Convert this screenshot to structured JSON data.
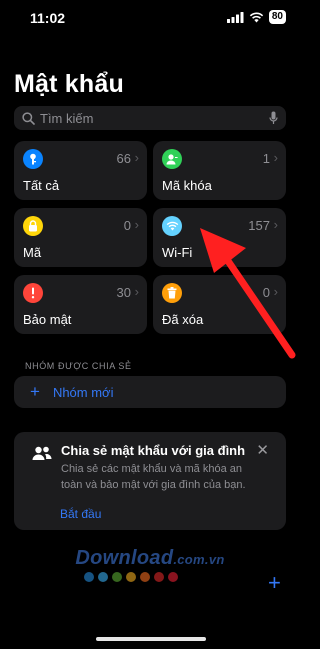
{
  "status_bar": {
    "time": "11:02",
    "battery": "80"
  },
  "title": "Mật khẩu",
  "search": {
    "placeholder": "Tìm kiếm"
  },
  "tiles": [
    {
      "label": "Tất cả",
      "count": "66",
      "icon": "key-icon",
      "color": "#0a84ff"
    },
    {
      "label": "Mã khóa",
      "count": "1",
      "icon": "person-icon",
      "color": "#30d158"
    },
    {
      "label": "Mã",
      "count": "0",
      "icon": "lock-icon",
      "color": "#ffd60a"
    },
    {
      "label": "Wi-Fi",
      "count": "157",
      "icon": "wifi-icon",
      "color": "#64d2ff"
    },
    {
      "label": "Bảo mật",
      "count": "30",
      "icon": "exclamation-icon",
      "color": "#ff453a"
    },
    {
      "label": "Đã xóa",
      "count": "0",
      "icon": "trash-icon",
      "color": "#ff9f0a"
    }
  ],
  "shared_section": {
    "header": "NHÓM ĐƯỢC CHIA SẺ",
    "new_group": "Nhóm mới"
  },
  "family_card": {
    "title": "Chia sẻ mật khẩu với gia đình",
    "description": "Chia sẻ các mật khẩu và mã khóa an toàn và bảo mật với gia đình của bạn.",
    "action": "Bắt đầu"
  },
  "watermark": {
    "brand": "Download",
    "domain": ".com.vn"
  },
  "watermark_dot_colors": [
    "#1e6fae",
    "#2e8bc0",
    "#4a8a2a",
    "#c08a1a",
    "#c0561a",
    "#b02020",
    "#b81a2a"
  ],
  "colors": {
    "accent": "#3478f6",
    "background": "#000000",
    "card": "#1c1c1e",
    "arrow": "#ff2020"
  }
}
